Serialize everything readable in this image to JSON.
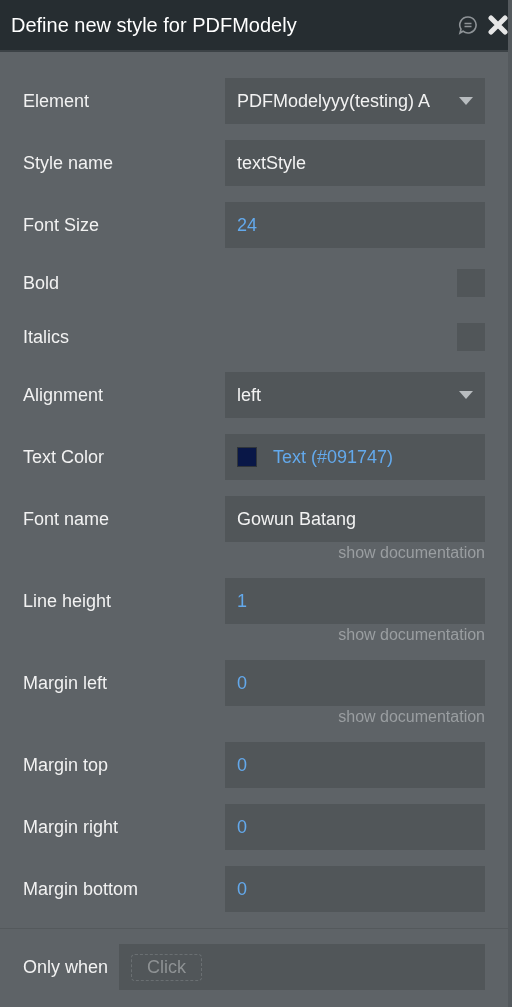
{
  "header": {
    "title": "Define new style for PDFModely"
  },
  "rows": [
    {
      "kind": "dropdown",
      "label": "Element",
      "value": "PDFModelyyy(testing) A"
    },
    {
      "kind": "text",
      "label": "Style name",
      "value": "textStyle"
    },
    {
      "kind": "number",
      "label": "Font Size",
      "value": "24"
    },
    {
      "kind": "checkbox",
      "label": "Bold",
      "checked": false
    },
    {
      "kind": "checkbox",
      "label": "Italics",
      "checked": false
    },
    {
      "kind": "dropdown",
      "label": "Alignment",
      "value": "left"
    },
    {
      "kind": "color",
      "label": "Text Color",
      "value": "Text (#091747)",
      "color": "#091747"
    },
    {
      "kind": "text",
      "label": "Font name",
      "value": "Gowun Batang",
      "doc_link": "show documentation"
    },
    {
      "kind": "number",
      "label": "Line height",
      "value": "1",
      "doc_link": "show documentation"
    },
    {
      "kind": "number",
      "label": "Margin left",
      "value": "0",
      "doc_link": "show documentation"
    },
    {
      "kind": "number",
      "label": "Margin top",
      "value": "0"
    },
    {
      "kind": "number",
      "label": "Margin right",
      "value": "0"
    },
    {
      "kind": "number",
      "label": "Margin bottom",
      "value": "0"
    }
  ],
  "only_when": {
    "label": "Only when",
    "placeholder": "Click"
  }
}
